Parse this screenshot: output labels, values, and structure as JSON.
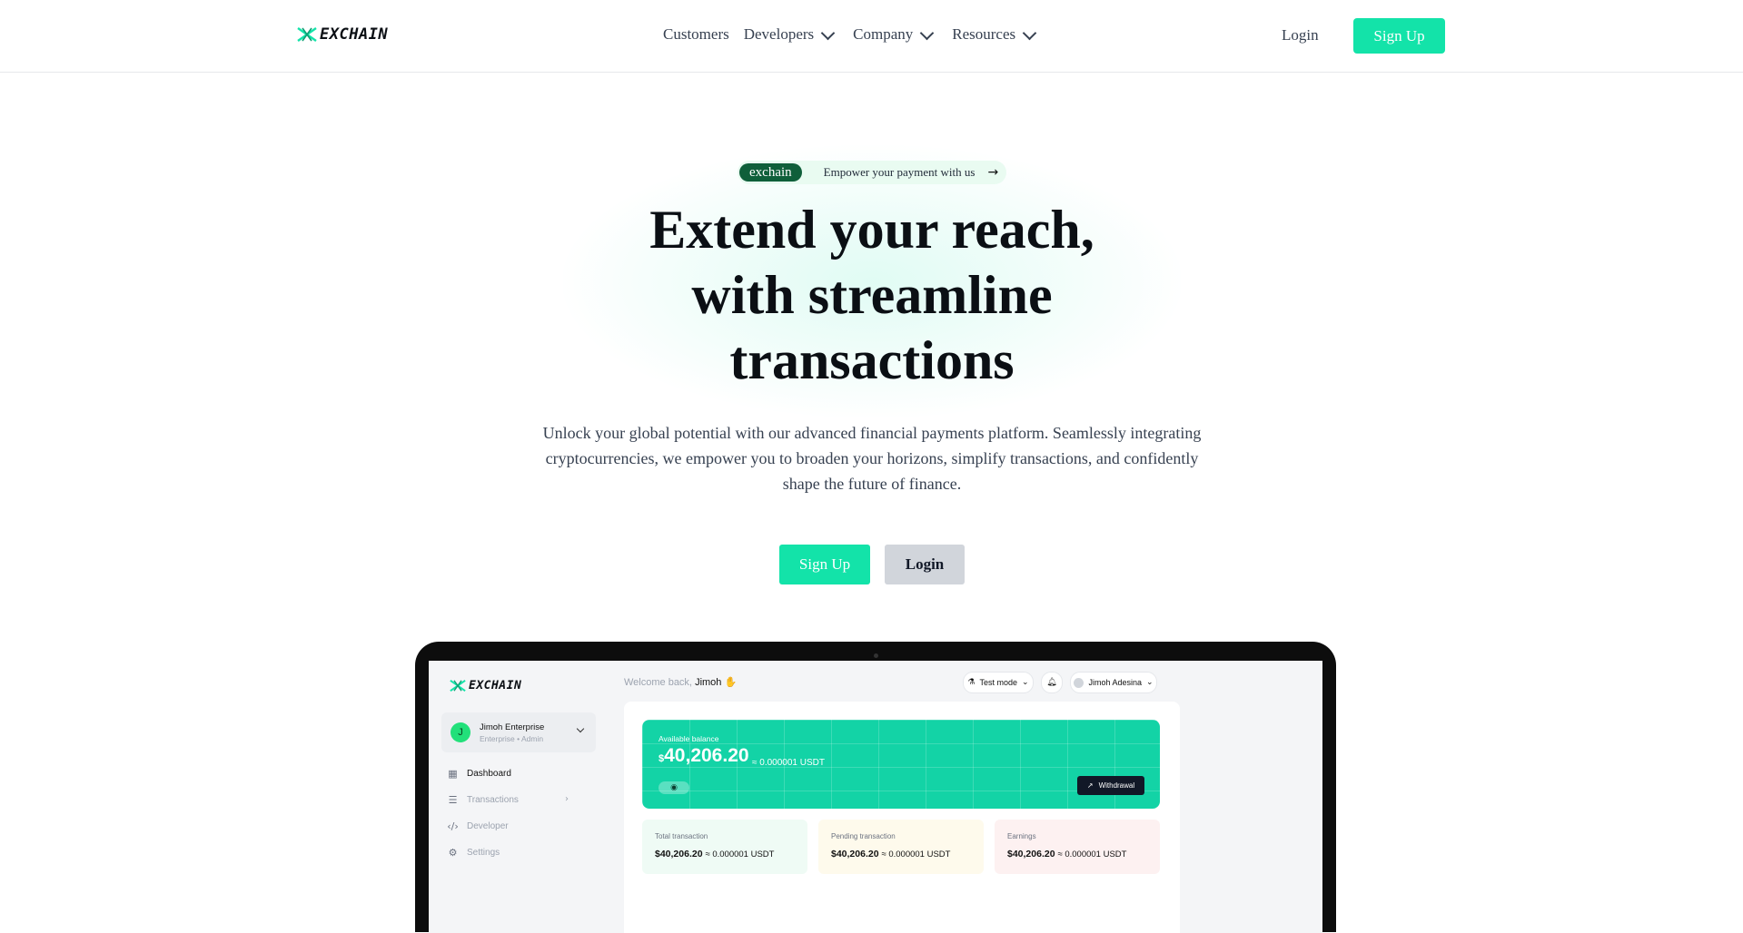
{
  "nav": {
    "logo_text": "EXCHAIN",
    "menu": [
      {
        "label": "Customers",
        "dropdown": false
      },
      {
        "label": "Developers",
        "dropdown": true
      },
      {
        "label": "Company",
        "dropdown": true
      },
      {
        "label": "Resources",
        "dropdown": true
      }
    ],
    "login": "Login",
    "signup": "Sign Up"
  },
  "hero": {
    "pill_tag": "exchain",
    "pill_text": "Empower your payment with us",
    "pill_arrow_icon": "arrow-right-icon",
    "title_line1": "Extend your reach,",
    "title_line2": "with streamline",
    "title_line3": "transactions",
    "subtitle": "Unlock your global potential with our advanced financial payments platform. Seamlessly integrating cryptocurrencies, we empower you to broaden your horizons, simplify transactions, and confidently shape the future of finance.",
    "signup_button": "Sign Up",
    "login_button": "Login"
  },
  "dashboard": {
    "logo_text": "EXCHAIN",
    "org_initial": "J",
    "org_name": "Jimoh Enterprise",
    "org_role": "Enterprise • Admin",
    "sidebar": [
      {
        "label": "Dashboard",
        "icon": "grid-icon",
        "active": true
      },
      {
        "label": "Transactions",
        "icon": "document-icon",
        "active": false
      },
      {
        "label": "Developer",
        "icon": "code-icon",
        "active": false
      },
      {
        "label": "Settings",
        "icon": "gear-icon",
        "active": false
      }
    ],
    "welcome_prefix": "Welcome back,",
    "welcome_name": "Jimoh",
    "welcome_emoji": "✋",
    "test_mode": "Test mode",
    "user_name": "Jimoh Adesina",
    "balance_label": "Available balance",
    "balance_currency": "$",
    "balance_amount": "40,206.20",
    "balance_usdt": "≈ 0.000001 USDT",
    "withdraw_label": "Withdrawal",
    "stats": [
      {
        "label": "Total transaction",
        "value": "$40,206.20",
        "usdt": "≈ 0.000001 USDT",
        "color": "#effbf5"
      },
      {
        "label": "Pending transaction",
        "value": "$40,206.20",
        "usdt": "≈ 0.000001 USDT",
        "color": "#fefaec"
      },
      {
        "label": "Earnings",
        "value": "$40,206.20",
        "usdt": "≈ 0.000001 USDT",
        "color": "#fdf1f1"
      }
    ]
  },
  "colors": {
    "accent": "#13e3a9",
    "dark_green": "#0f5f3a",
    "balance_card": "#13d3a6"
  }
}
